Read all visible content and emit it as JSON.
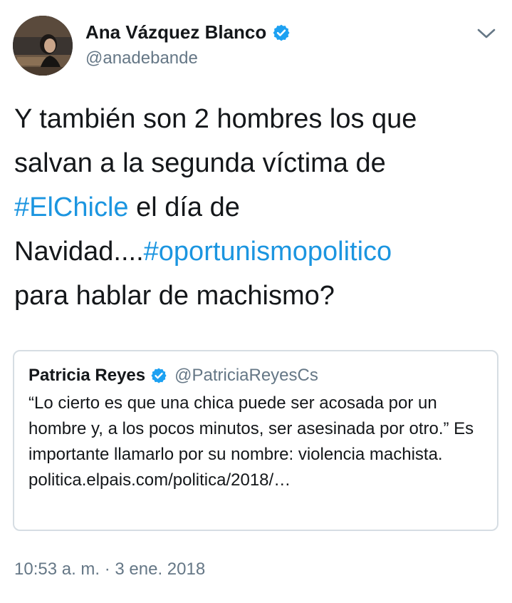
{
  "author": {
    "display_name": "Ana Vázquez Blanco",
    "handle": "@anadebande",
    "verified": true
  },
  "tweet": {
    "line1": "Y también son 2 hombres los que",
    "line2": "salvan a la segunda víctima de",
    "hashtag1": "#ElChicle",
    "line3_rest": " el día de",
    "line4_start": "Navidad....",
    "hashtag2": "#oportunismopolitico",
    "line5": "para hablar de machismo?"
  },
  "quoted_tweet": {
    "display_name": "Patricia Reyes",
    "handle": "@PatriciaReyesCs",
    "verified": true,
    "text": "“Lo cierto es que una chica puede ser acosada por un hombre y, a los pocos minutos, ser asesinada por otro.” Es importante llamarlo por su nombre: violencia machista.",
    "link": "politica.elpais.com/politica/2018/…"
  },
  "timestamp": "10:53 a. m. · 3 ene. 2018",
  "icons": {
    "verified": "verified-badge-icon",
    "menu": "chevron-down-icon"
  },
  "colors": {
    "hashtag": "#1b95e0",
    "verified": "#1da1f2",
    "secondary_text": "#657786",
    "border": "#d6dde3"
  }
}
